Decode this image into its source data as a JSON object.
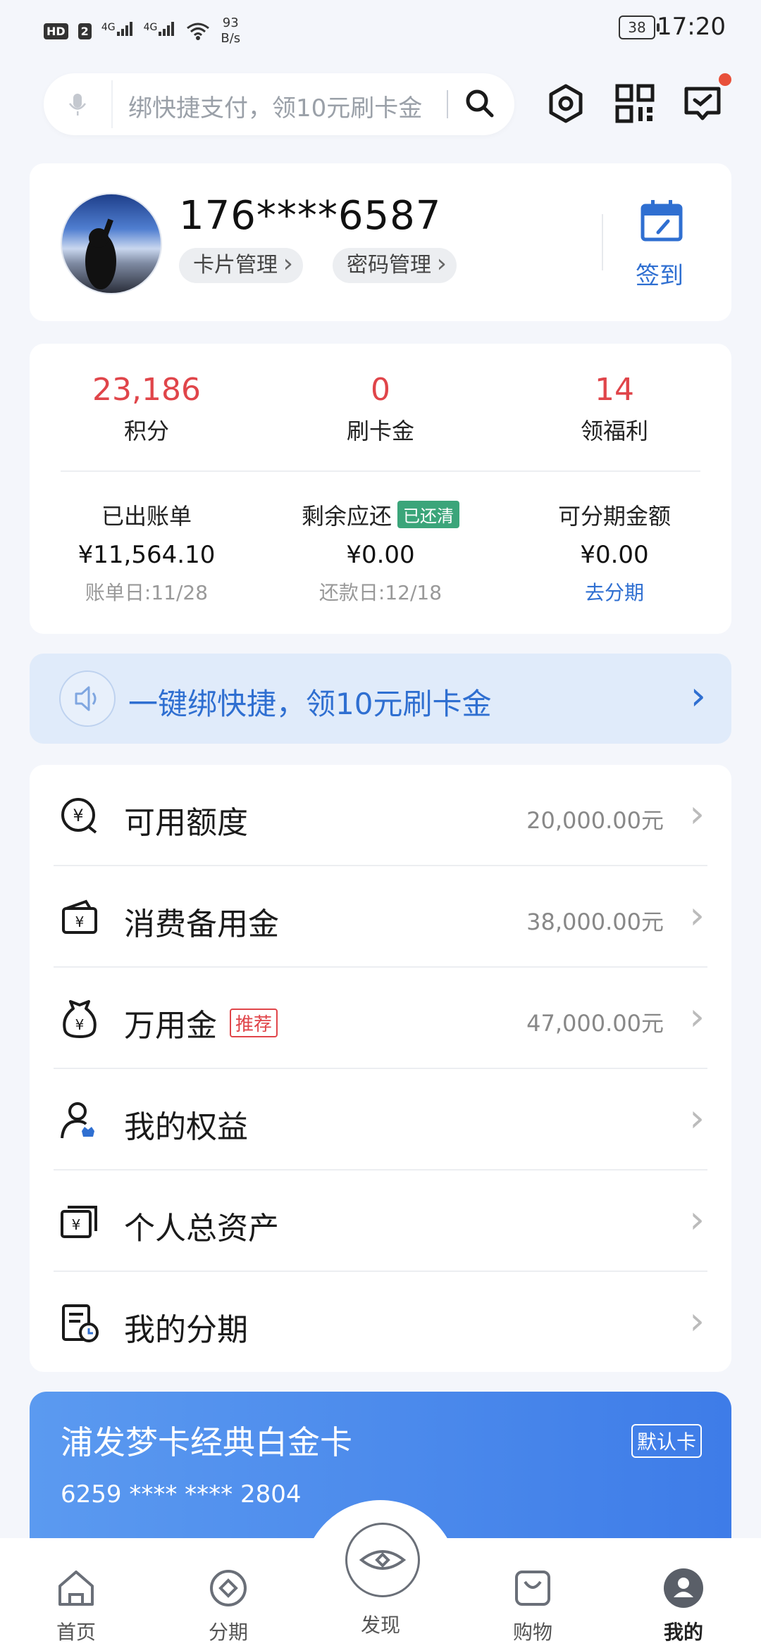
{
  "status": {
    "time": "17:20",
    "battery": "38",
    "net_speed": "93",
    "net_unit": "B/s",
    "sim": "HD",
    "sim_num": "2",
    "sig1": "4G",
    "sig2": "4G"
  },
  "search": {
    "placeholder": "绑快捷支付，领10元刷卡金"
  },
  "profile": {
    "phone": "176****6587",
    "card_mgmt": "卡片管理",
    "pwd_mgmt": "密码管理",
    "sign_in": "签到"
  },
  "stats": [
    {
      "value": "23,186",
      "label": "积分"
    },
    {
      "value": "0",
      "label": "刷卡金"
    },
    {
      "value": "14",
      "label": "领福利"
    }
  ],
  "bills": [
    {
      "title": "已出账单",
      "value": "¥11,564.10",
      "sub": "账单日:11/28"
    },
    {
      "title": "剩余应还",
      "badge": "已还清",
      "value": "¥0.00",
      "sub": "还款日:12/18"
    },
    {
      "title": "可分期金额",
      "value": "¥0.00",
      "sub": "去分期"
    }
  ],
  "banner": {
    "text": "一键绑快捷，领10元刷卡金"
  },
  "list": [
    {
      "label": "可用额度",
      "value": "20,000.00元",
      "icon": "yuan-magnifier-icon"
    },
    {
      "label": "消费备用金",
      "value": "38,000.00元",
      "icon": "wallet-icon"
    },
    {
      "label": "万用金",
      "tag": "推荐",
      "value": "47,000.00元",
      "icon": "money-bag-icon"
    },
    {
      "label": "我的权益",
      "value": "",
      "icon": "user-crown-icon"
    },
    {
      "label": "个人总资产",
      "value": "",
      "icon": "assets-icon"
    },
    {
      "label": "我的分期",
      "value": "",
      "icon": "installment-doc-icon"
    }
  ],
  "card": {
    "name": "浦发梦卡经典白金卡",
    "number": "6259 **** **** 2804",
    "default": "默认卡"
  },
  "tabs": [
    {
      "label": "首页",
      "icon": "home-icon"
    },
    {
      "label": "分期",
      "icon": "installment-icon"
    },
    {
      "label": "发现",
      "icon": "eye-icon"
    },
    {
      "label": "购物",
      "icon": "shopping-bag-icon"
    },
    {
      "label": "我的",
      "icon": "profile-icon"
    }
  ],
  "colors": {
    "accent": "#2f6fd1",
    "red": "#e0454a",
    "green": "#3ba57a"
  }
}
